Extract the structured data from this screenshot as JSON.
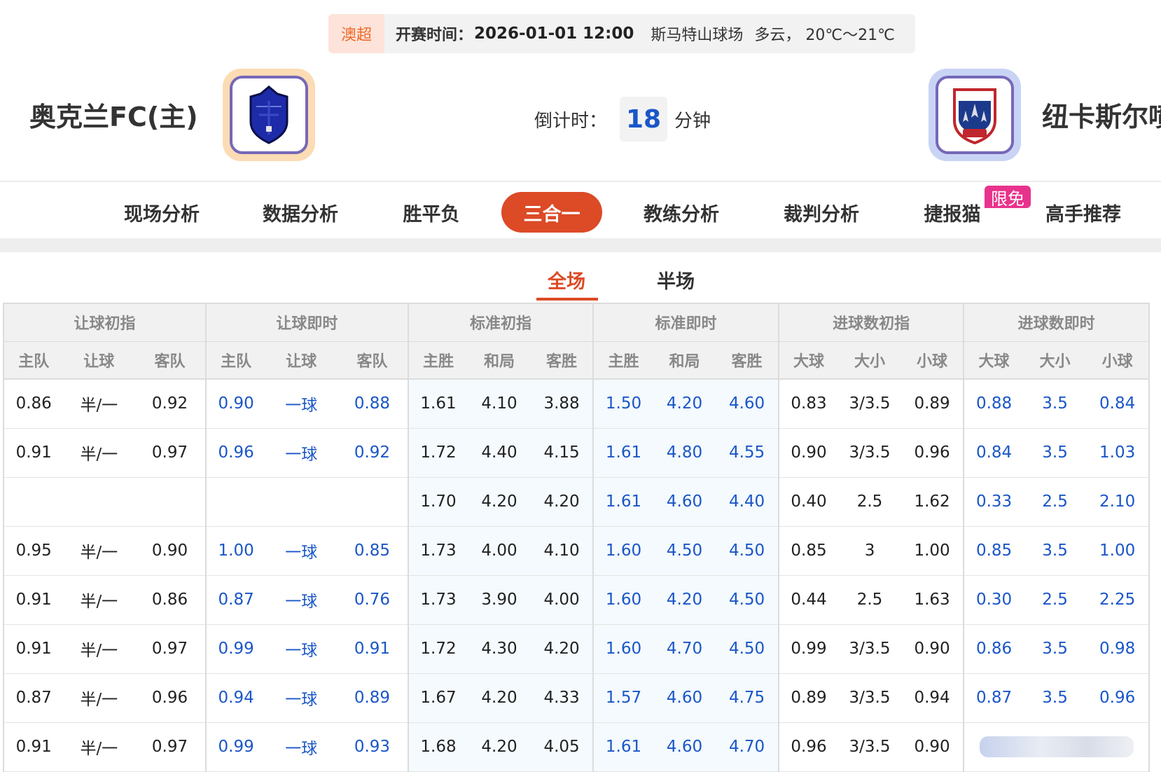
{
  "match": {
    "league": "澳超",
    "kickoff_label": "开赛时间：",
    "kickoff_time": "2026-01-01 12:00",
    "venue": "斯马特山球场",
    "weather": "多云， 20℃～21℃",
    "home_team": "奥克兰FC(主)",
    "away_team": "纽卡斯尔喷",
    "countdown_label": "倒计时：",
    "countdown_value": "18",
    "countdown_unit": "分钟"
  },
  "nav": {
    "items": [
      "现场分析",
      "数据分析",
      "胜平负",
      "三合一",
      "教练分析",
      "裁判分析",
      "捷报猫",
      "高手推荐"
    ],
    "active": "三合一",
    "badge": "限免"
  },
  "subtabs": {
    "items": [
      "全场",
      "半场"
    ],
    "active": "全场"
  },
  "table": {
    "groups": [
      "让球初指",
      "让球即时",
      "标准初指",
      "标准即时",
      "进球数初指",
      "进球数即时"
    ],
    "subheaders": [
      "主队",
      "让球",
      "客队",
      "主队",
      "让球",
      "客队",
      "主胜",
      "和局",
      "客胜",
      "主胜",
      "和局",
      "客胜",
      "大球",
      "大小",
      "小球",
      "大球",
      "大小",
      "小球"
    ],
    "rows": [
      [
        "0.86",
        "半/一",
        "0.92",
        "0.90",
        "一球",
        "0.88",
        "1.61",
        "4.10",
        "3.88",
        "1.50",
        "4.20",
        "4.60",
        "0.83",
        "3/3.5",
        "0.89",
        "0.88",
        "3.5",
        "0.84"
      ],
      [
        "0.91",
        "半/一",
        "0.97",
        "0.96",
        "一球",
        "0.92",
        "1.72",
        "4.40",
        "4.15",
        "1.61",
        "4.80",
        "4.55",
        "0.90",
        "3/3.5",
        "0.96",
        "0.84",
        "3.5",
        "1.03"
      ],
      [
        "",
        "",
        "",
        "",
        "",
        "",
        "1.70",
        "4.20",
        "4.20",
        "1.61",
        "4.60",
        "4.40",
        "0.40",
        "2.5",
        "1.62",
        "0.33",
        "2.5",
        "2.10"
      ],
      [
        "0.95",
        "半/一",
        "0.90",
        "1.00",
        "一球",
        "0.85",
        "1.73",
        "4.00",
        "4.10",
        "1.60",
        "4.50",
        "4.50",
        "0.85",
        "3",
        "1.00",
        "0.85",
        "3.5",
        "1.00"
      ],
      [
        "0.91",
        "半/一",
        "0.86",
        "0.87",
        "一球",
        "0.76",
        "1.73",
        "3.90",
        "4.00",
        "1.60",
        "4.20",
        "4.50",
        "0.44",
        "2.5",
        "1.63",
        "0.30",
        "2.5",
        "2.25"
      ],
      [
        "0.91",
        "半/一",
        "0.97",
        "0.99",
        "一球",
        "0.91",
        "1.72",
        "4.30",
        "4.20",
        "1.60",
        "4.70",
        "4.50",
        "0.99",
        "3/3.5",
        "0.90",
        "0.86",
        "3.5",
        "0.98"
      ],
      [
        "0.87",
        "半/一",
        "0.96",
        "0.94",
        "一球",
        "0.89",
        "1.67",
        "4.20",
        "4.33",
        "1.57",
        "4.60",
        "4.75",
        "0.89",
        "3/3.5",
        "0.94",
        "0.87",
        "3.5",
        "0.96"
      ],
      [
        "0.91",
        "半/一",
        "0.97",
        "0.99",
        "一球",
        "0.93",
        "1.68",
        "4.20",
        "4.05",
        "1.61",
        "4.60",
        "4.70",
        "0.96",
        "3/3.5",
        "0.90",
        "",
        "",
        ""
      ]
    ]
  },
  "colors": {
    "accent": "#dc4a26",
    "live_odds": "#1a56c8",
    "league_tag": "#ee6a2a",
    "badge": "#e8338c"
  }
}
